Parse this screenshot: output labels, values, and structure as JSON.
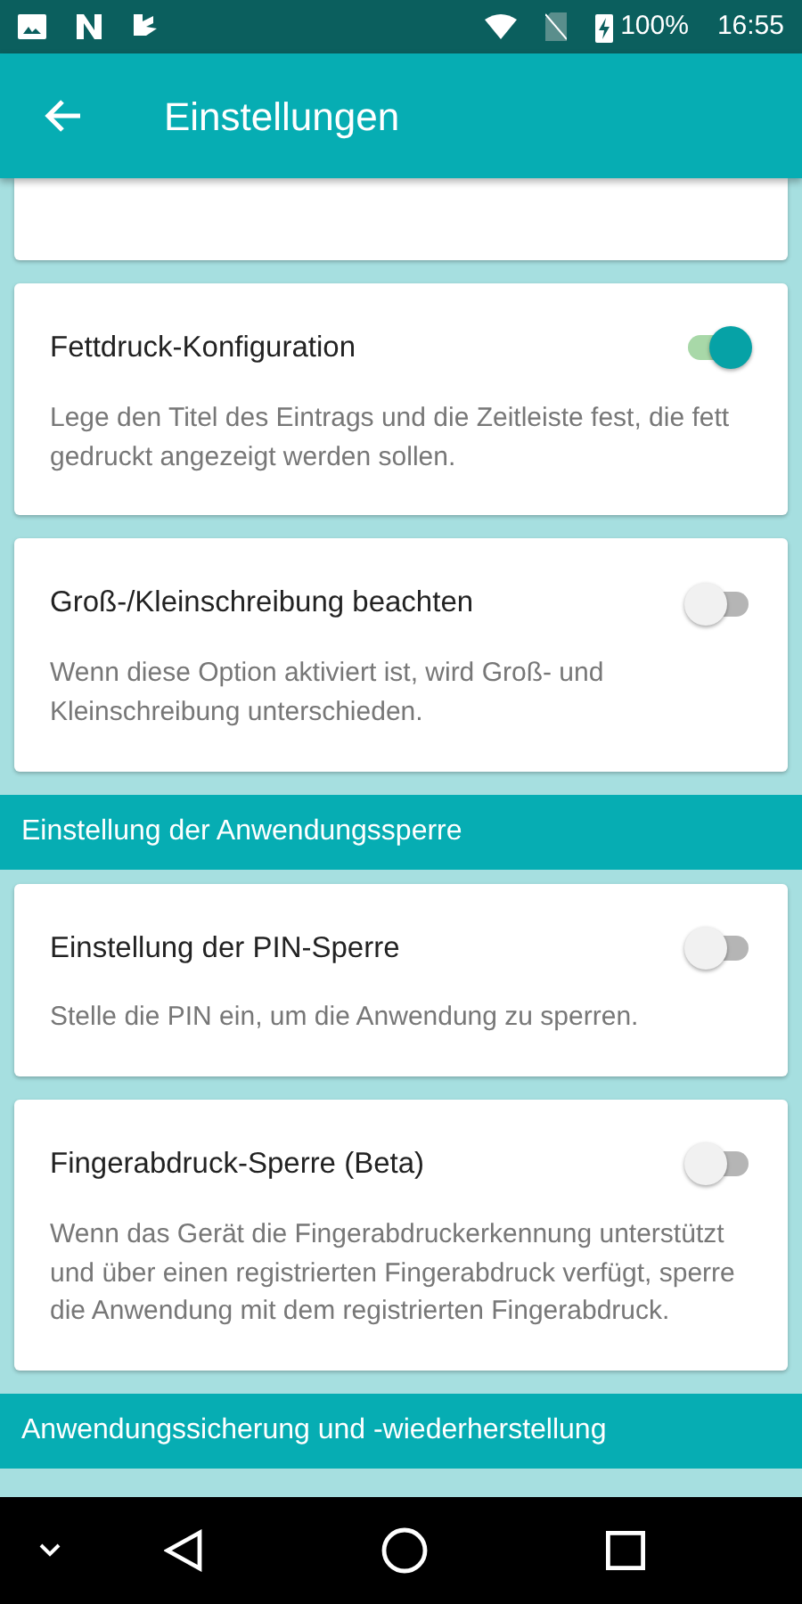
{
  "status_bar": {
    "battery": "100%",
    "time": "16:55"
  },
  "app_bar": {
    "title": "Einstellungen"
  },
  "items": [
    {
      "kind": "stub"
    },
    {
      "kind": "setting",
      "title": "Fettdruck-Konfiguration",
      "description": "Lege den Titel des Eintrags und die Zeitleiste fest, die fett gedruckt angezeigt werden sollen.",
      "on": true
    },
    {
      "kind": "setting",
      "title": "Groß-/Kleinschreibung beachten",
      "description": "Wenn diese Option aktiviert ist, wird Groß- und Kleinschreibung unterschieden.",
      "on": false
    },
    {
      "kind": "section",
      "title": "Einstellung der Anwendungssperre"
    },
    {
      "kind": "setting",
      "title": "Einstellung der PIN-Sperre",
      "description": "Stelle die PIN ein, um die Anwendung zu sperren.",
      "on": false
    },
    {
      "kind": "setting",
      "title": "Fingerabdruck-Sperre (Beta)",
      "description": "Wenn das Gerät die Fingerabdruckerkennung unterstützt und über einen registrierten Fingerabdruck verfügt, sperre die Anwendung mit dem registrierten Fingerabdruck.",
      "on": false
    },
    {
      "kind": "section",
      "title": "Anwendungssicherung und -wiederherstellung"
    }
  ]
}
